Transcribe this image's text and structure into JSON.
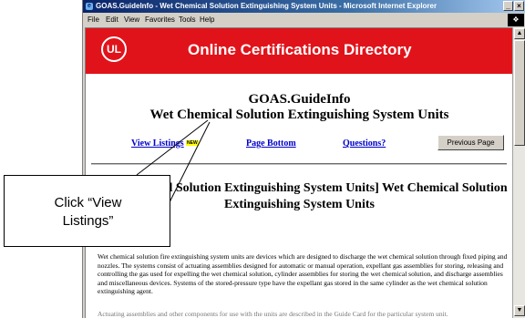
{
  "window": {
    "title": "GOAS.GuideInfo - Wet Chemical Solution Extinguishing System Units - Microsoft Internet Explorer",
    "buttons": [
      "_",
      "×"
    ]
  },
  "menubar": {
    "items": [
      "File",
      "Edit",
      "View",
      "Favorites",
      "Tools",
      "Help"
    ]
  },
  "banner": {
    "logo_text": "UL",
    "title": "Online Certifications Directory",
    "color": "#e1131a"
  },
  "page": {
    "heading_line1": "GOAS.GuideInfo",
    "heading_line2": "Wet Chemical Solution Extinguishing System Units"
  },
  "nav": {
    "view_listings": "View Listings",
    "new_badge": "NEW",
    "page_bottom": "Page Bottom",
    "questions": "Questions?",
    "previous_page": "Previous Page",
    "link_color": "#0000cc"
  },
  "section": {
    "title_line1": "[Wet Chemical Solution Extinguishing System Units] Wet Chemical Solution",
    "title_line2": "Extinguishing System Units",
    "paragraph": "Wet chemical solution fire extinguishing system units are devices which are designed to discharge the wet chemical solution through fixed piping and nozzles. The systems consist of actuating assemblies designed for automatic or manual operation, expellant gas assemblies for storing, releasing and controlling the gas used for expelling the wet chemical solution, cylinder assemblies for storing the wet chemical solution, and discharge assemblies and miscellaneous devices. Systems of the stored-pressure type have the expellant gas stored in the same cylinder as the wet chemical solution extinguishing agent.",
    "paragraph2": "Actuating assemblies and other components for use with the units are described in the Guide Card for the particular system unit."
  },
  "callout": {
    "text_line1": "Click “View",
    "text_line2": "Listings”"
  }
}
